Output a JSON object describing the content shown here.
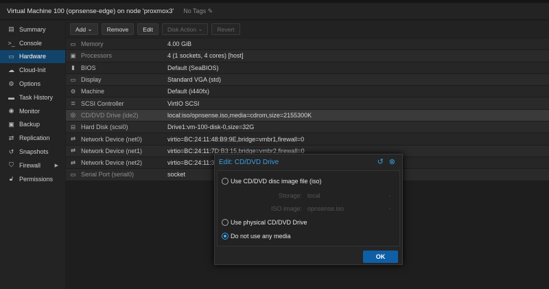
{
  "title": "Virtual Machine 100 (opnsense-edge) on node 'proxmox3'",
  "tags": "No Tags",
  "sidebar": {
    "items": [
      {
        "label": "Summary",
        "icon": "book-icon"
      },
      {
        "label": "Console",
        "icon": "terminal-icon"
      },
      {
        "label": "Hardware",
        "icon": "monitor-icon",
        "selected": true
      },
      {
        "label": "Cloud-Init",
        "icon": "cloud-icon"
      },
      {
        "label": "Options",
        "icon": "gear-icon"
      },
      {
        "label": "Task History",
        "icon": "list-icon"
      },
      {
        "label": "Monitor",
        "icon": "eye-icon"
      },
      {
        "label": "Backup",
        "icon": "floppy-icon"
      },
      {
        "label": "Replication",
        "icon": "retweet-icon"
      },
      {
        "label": "Snapshots",
        "icon": "history-icon"
      },
      {
        "label": "Firewall",
        "icon": "shield-icon"
      },
      {
        "label": "Permissions",
        "icon": "unlock-icon"
      }
    ]
  },
  "toolbar": {
    "add": "Add",
    "remove": "Remove",
    "edit": "Edit",
    "disk_action": "Disk Action",
    "revert": "Revert"
  },
  "hardware": [
    {
      "key": "Memory",
      "value": "4.00 GiB",
      "icon": "memory-icon"
    },
    {
      "key": "Processors",
      "value": "4 (1 sockets, 4 cores) [host]",
      "icon": "cpu-icon"
    },
    {
      "key": "BIOS",
      "value": "Default (SeaBIOS)",
      "icon": "microchip-icon"
    },
    {
      "key": "Display",
      "value": "Standard VGA (std)",
      "icon": "desktop-icon"
    },
    {
      "key": "Machine",
      "value": "Default (i440fx)",
      "icon": "cogs-icon"
    },
    {
      "key": "SCSI Controller",
      "value": "VirtIO SCSI",
      "icon": "database-icon"
    },
    {
      "key": "CD/DVD Drive (ide2)",
      "value": "local:iso/opnsense.iso,media=cdrom,size=2155300K",
      "icon": "cdrom-icon"
    },
    {
      "key": "Hard Disk (scsi0)",
      "value": "Drive1:vm-100-disk-0,size=32G",
      "icon": "hdd-icon"
    },
    {
      "key": "Network Device (net0)",
      "value": "virtio=BC:24:11:48:B9:9E,bridge=vmbr1,firewall=0",
      "icon": "exchange-icon"
    },
    {
      "key": "Network Device (net1)",
      "value": "virtio=BC:24:11:7D:B3:15,bridge=vmbr2,firewall=0",
      "icon": "exchange-icon"
    },
    {
      "key": "Network Device (net2)",
      "value": "virtio=BC:24:11:31",
      "icon": "exchange-icon"
    },
    {
      "key": "Serial Port (serial0)",
      "value": "socket",
      "icon": "keyboard-icon"
    }
  ],
  "dialog": {
    "title": "Edit: CD/DVD Drive",
    "option_iso": "Use CD/DVD disc image file (iso)",
    "storage_label": "Storage:",
    "storage_value": "local",
    "iso_label": "ISO image:",
    "iso_value": "opnsense.iso",
    "option_physical": "Use physical CD/DVD Drive",
    "option_none": "Do not use any media",
    "selected_option": "Do not use any media",
    "ok": "OK"
  },
  "colors": {
    "accent": "#3a9ee4",
    "selected_nav": "#12446b",
    "ok_button": "#0f5fa6"
  }
}
